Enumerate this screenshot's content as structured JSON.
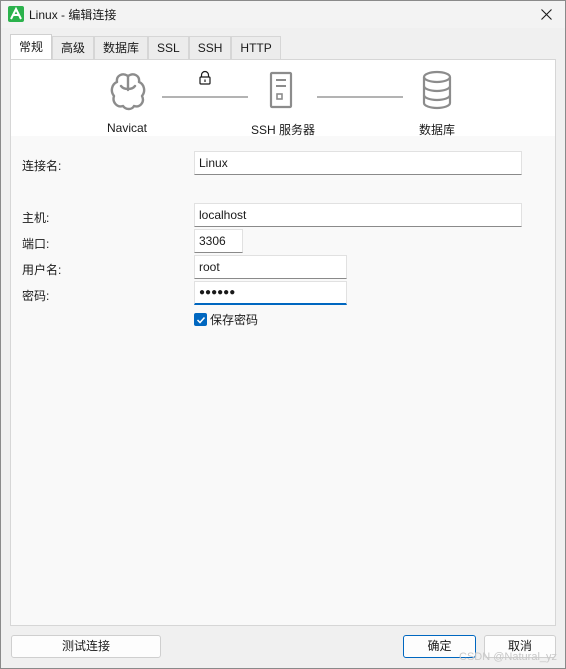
{
  "window": {
    "title": "Linux - 编辑连接"
  },
  "tabs": [
    {
      "label": "常规",
      "active": true
    },
    {
      "label": "高级",
      "active": false
    },
    {
      "label": "数据库",
      "active": false
    },
    {
      "label": "SSL",
      "active": false
    },
    {
      "label": "SSH",
      "active": false
    },
    {
      "label": "HTTP",
      "active": false
    }
  ],
  "diagram": {
    "nodes": [
      {
        "label": "Navicat",
        "icon": "navicat-logo-icon"
      },
      {
        "label": "SSH 服务器",
        "icon": "server-icon"
      },
      {
        "label": "数据库",
        "icon": "database-icon"
      }
    ],
    "link_icon": "lock-icon"
  },
  "form": {
    "connection_name": {
      "label": "连接名:",
      "value": "Linux"
    },
    "host": {
      "label": "主机:",
      "value": "localhost"
    },
    "port": {
      "label": "端口:",
      "value": "3306"
    },
    "username": {
      "label": "用户名:",
      "value": "root"
    },
    "password": {
      "label": "密码:",
      "value": "●●●●●●"
    },
    "save_password": {
      "label": "保存密码",
      "checked": true
    }
  },
  "buttons": {
    "test_connection": "测试连接",
    "ok": "确定",
    "cancel": "取消"
  },
  "watermark": "CSDN @Natural_yz",
  "colors": {
    "accent": "#0067c0",
    "app_icon": "#2bb24c",
    "diagram_stroke": "#8c8c8c"
  }
}
